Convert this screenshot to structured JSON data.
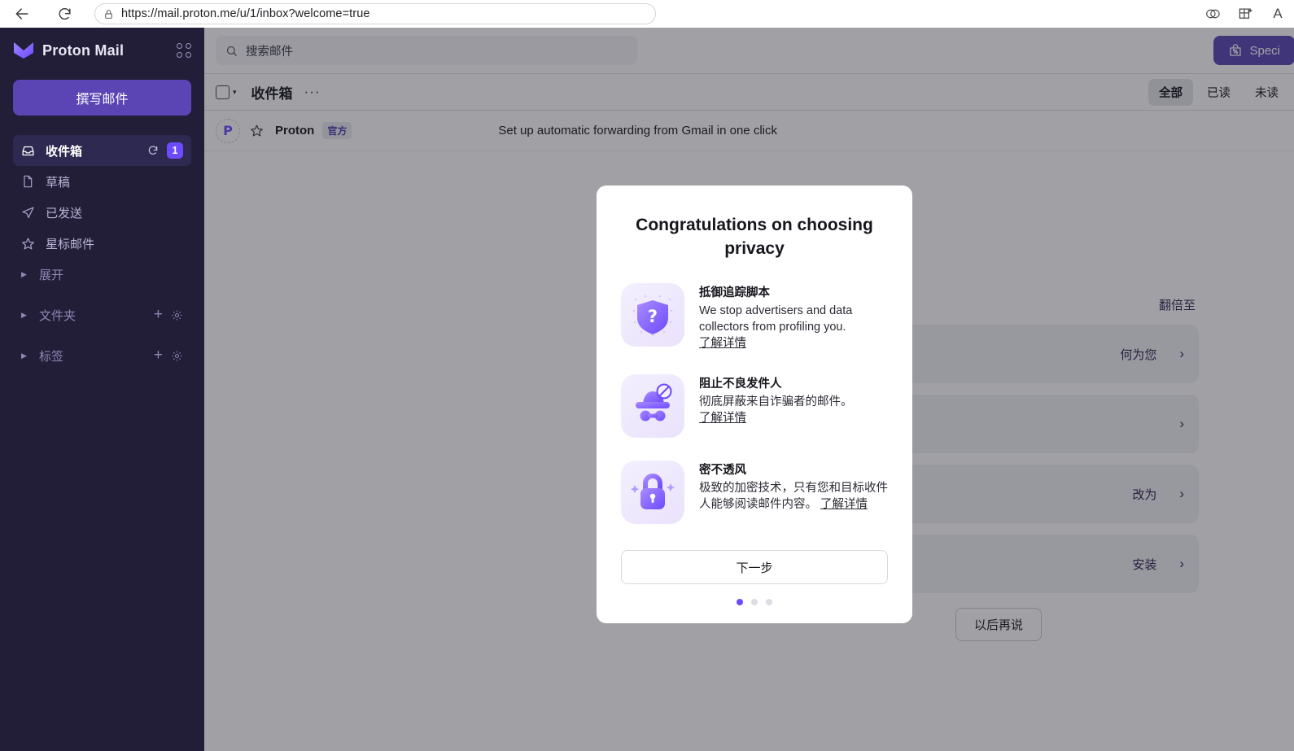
{
  "browser": {
    "url": "https://mail.proton.me/u/1/inbox?welcome=true",
    "back_icon": "back-arrow-icon",
    "reload_icon": "reload-icon",
    "lock_icon": "lock-icon",
    "split_screen_icon": "split-screen-icon",
    "add_panel_icon": "add-panel-icon",
    "font_icon": "A"
  },
  "sidebar": {
    "brand": "Proton Mail",
    "compose_label": "撰写邮件",
    "items": [
      {
        "label": "收件箱",
        "icon": "inbox-icon",
        "active": true,
        "count": "1",
        "refresh": true
      },
      {
        "label": "草稿",
        "icon": "draft-icon",
        "active": false
      },
      {
        "label": "已发送",
        "icon": "sent-icon",
        "active": false
      },
      {
        "label": "星标邮件",
        "icon": "star-icon",
        "active": false
      },
      {
        "label": "展开",
        "icon": "caret-right-icon",
        "active": false,
        "collapsible": true
      }
    ],
    "groups": [
      {
        "label": "文件夹",
        "add": "+",
        "settings": "gear-icon"
      },
      {
        "label": "标签",
        "add": "+",
        "settings": "gear-icon"
      }
    ]
  },
  "topbar": {
    "search_placeholder": "搜索邮件",
    "special_offer_label": "Speci"
  },
  "list_header": {
    "folder_title": "收件箱",
    "more_label": "···",
    "filters": [
      {
        "label": "全部",
        "active": true
      },
      {
        "label": "已读",
        "active": false
      },
      {
        "label": "未读",
        "active": false
      }
    ]
  },
  "mail_row": {
    "avatar_letter": "P",
    "sender": "Proton",
    "badge": "官方",
    "subject": "Set up automatic forwarding from Gmail in one click"
  },
  "checklist": {
    "heading": "翻倍至",
    "cards": [
      {
        "text": "何为您"
      },
      {
        "text": ""
      },
      {
        "text": "改为"
      },
      {
        "text": "安装"
      }
    ],
    "later_label": "以后再说",
    "chevron": "›"
  },
  "modal": {
    "title": "Congratulations on choosing privacy",
    "features": [
      {
        "icon": "shield-question-icon",
        "title": "抵御追踪脚本",
        "desc": "We stop advertisers and data collectors from profiling you.",
        "link": "了解详情",
        "link_inline": false
      },
      {
        "icon": "incognito-blocked-icon",
        "title": "阻止不良发件人",
        "desc": "彻底屏蔽来自诈骗者的邮件。",
        "link": "了解详情",
        "link_inline": false
      },
      {
        "icon": "lock-sparkle-icon",
        "title": "密不透风",
        "desc": "极致的加密技术，只有您和目标收件人能够阅读邮件内容。",
        "link": "了解详情",
        "link_inline": true
      }
    ],
    "next_label": "下一步",
    "dots": [
      true,
      false,
      false
    ]
  },
  "colors": {
    "brand_purple": "#6d4aff",
    "compose_purple": "#5b45b5",
    "sidebar_bg": "#221e38",
    "overlay": "#96979b"
  }
}
